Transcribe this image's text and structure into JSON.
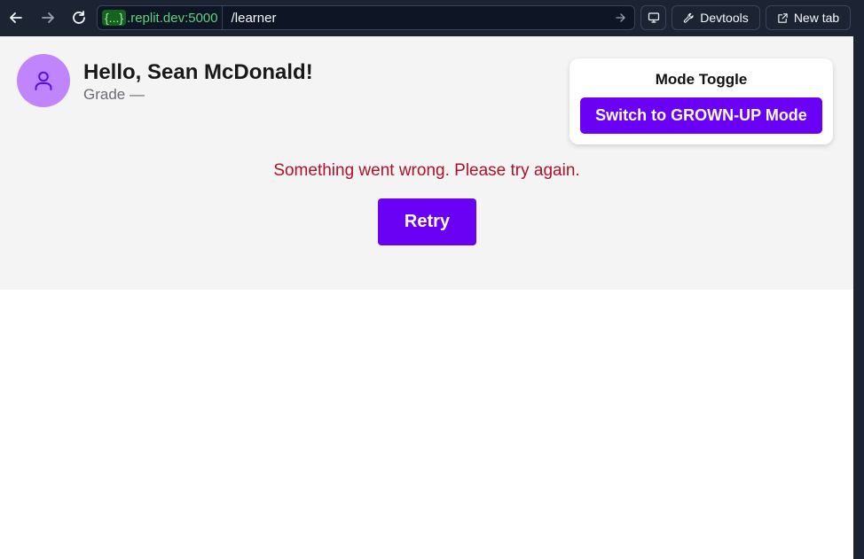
{
  "browser": {
    "url_host_brace": "{...}",
    "url_host": ".replit.dev:5000",
    "url_path": "/learner",
    "devtools_label": "Devtools",
    "new_tab_label": "New tab",
    "icons": {
      "back": "arrow-left-icon",
      "forward": "arrow-right-icon",
      "reload": "reload-icon",
      "go": "arrow-right-icon",
      "screen": "monitor-icon",
      "devtools": "wrench-icon",
      "new_tab": "external-link-icon"
    }
  },
  "learner": {
    "greeting": "Hello, Sean McDonald!",
    "grade": "Grade —",
    "avatar_icon": "user-icon",
    "avatar_color": "#c084fc"
  },
  "mode_toggle": {
    "title": "Mode Toggle",
    "button_label": "Switch to GROWN-UP Mode"
  },
  "error": {
    "message": "Something went wrong. Please try again.",
    "retry_label": "Retry"
  },
  "colors": {
    "accent": "#6a00f4",
    "error": "#b0102a",
    "chrome_bg": "#1c2333",
    "url_host": "#5fd37a"
  }
}
